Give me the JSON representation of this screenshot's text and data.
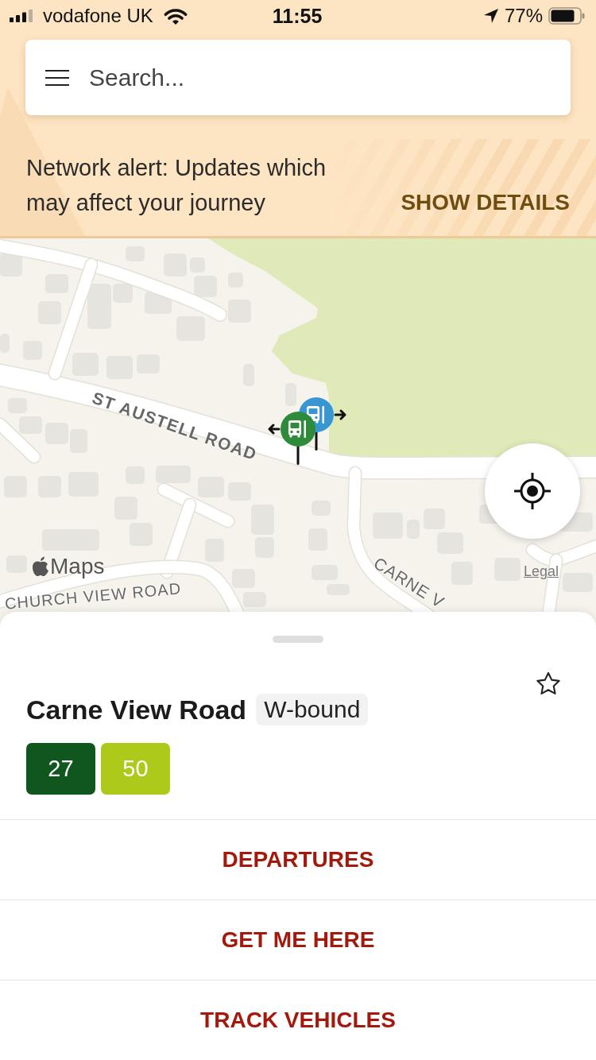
{
  "status_bar": {
    "carrier": "vodafone UK",
    "time": "11:55",
    "battery": "77%"
  },
  "search": {
    "placeholder": "Search..."
  },
  "alert": {
    "message": "Network alert: Updates which may affect your journey",
    "action": "SHOW DETAILS"
  },
  "map": {
    "road_labels": [
      {
        "text": "ST AUSTELL ROAD"
      },
      {
        "text": "CHURCH VIEW ROAD"
      },
      {
        "text": "CARNE V"
      }
    ],
    "stops": [
      {
        "color": "#3896d3",
        "kind": "rightward"
      },
      {
        "color": "#2e8b3a",
        "kind": "leftward"
      }
    ],
    "attribution": "Maps",
    "legal": "Legal"
  },
  "stop": {
    "name": "Carne View Road",
    "direction": "W-bound",
    "favorite": false,
    "routes": [
      {
        "number": "27",
        "color": "#10561f"
      },
      {
        "number": "50",
        "color": "#adc91a"
      }
    ]
  },
  "actions": [
    {
      "label": "DEPARTURES"
    },
    {
      "label": "GET ME HERE"
    },
    {
      "label": "TRACK VEHICLES"
    }
  ]
}
